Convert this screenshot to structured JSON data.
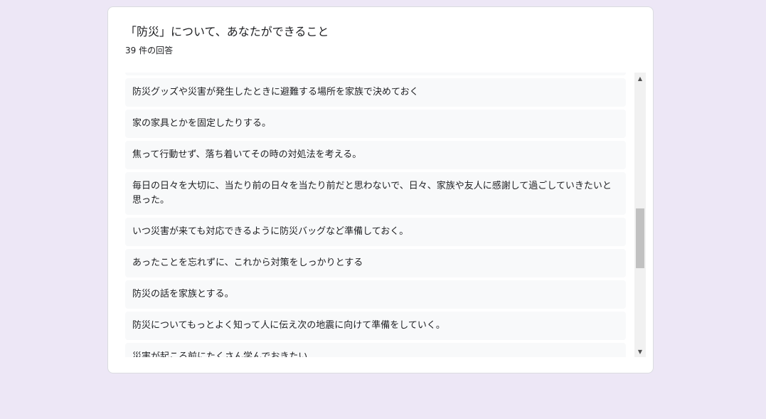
{
  "form": {
    "question_title": "「防災」について、あなたができること",
    "response_count": "39 件の回答"
  },
  "responses": [
    "",
    "防災グッズや災害が発生したときに避難する場所を家族で決めておく",
    "家の家具とかを固定したりする。",
    "焦って行動せず、落ち着いてその時の対処法を考える。",
    "毎日の日々を大切に、当たり前の日々を当たり前だと思わないで、日々、家族や友人に感謝して過ごしていきたいと思った。",
    "いつ災害が来ても対応できるように防災バッグなど準備しておく。",
    "あったことを忘れずに、これから対策をしっかりとする",
    "防災の話を家族とする。",
    "防災についてもっとよく知って人に伝え次の地震に向けて準備をしていく。",
    "災害が起こる前にたくさん学んでおきたい"
  ],
  "scrollbar": {
    "up_icon": "▲",
    "down_icon": "▼",
    "position_fraction": 0.55
  }
}
